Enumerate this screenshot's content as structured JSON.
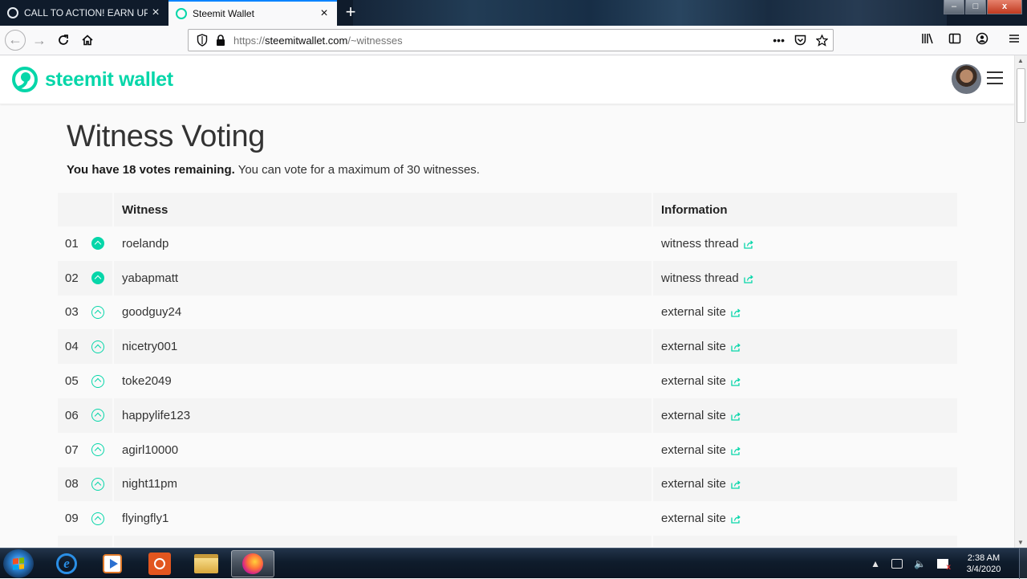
{
  "browser": {
    "tabs": [
      {
        "title": "CALL TO ACTION! EARN UPVO",
        "close": "×"
      },
      {
        "title": "Steemit Wallet",
        "close": "×"
      }
    ],
    "new_tab": "+",
    "url_scheme": "https://",
    "url_host": "steemitwallet.com",
    "url_path": "/~witnesses",
    "url_actions": "•••",
    "window_controls": {
      "minimize": "–",
      "maximize": "□",
      "close": "x"
    }
  },
  "site": {
    "brand": "steemit wallet",
    "brand_color": "#06d6a9"
  },
  "main": {
    "title": "Witness Voting",
    "votes_bold": "You have 18 votes remaining.",
    "votes_rest": " You can vote for a maximum of 30 witnesses.",
    "columns": {
      "witness": "Witness",
      "information": "Information"
    },
    "rows": [
      {
        "rank": "01",
        "name": "roelandp",
        "info": "witness thread",
        "voted": true
      },
      {
        "rank": "02",
        "name": "yabapmatt",
        "info": "witness thread",
        "voted": true
      },
      {
        "rank": "03",
        "name": "goodguy24",
        "info": "external site",
        "voted": false
      },
      {
        "rank": "04",
        "name": "nicetry001",
        "info": "external site",
        "voted": false
      },
      {
        "rank": "05",
        "name": "toke2049",
        "info": "external site",
        "voted": false
      },
      {
        "rank": "06",
        "name": "happylife123",
        "info": "external site",
        "voted": false
      },
      {
        "rank": "07",
        "name": "agirl10000",
        "info": "external site",
        "voted": false
      },
      {
        "rank": "08",
        "name": "night11pm",
        "info": "external site",
        "voted": false
      },
      {
        "rank": "09",
        "name": "flyingfly1",
        "info": "external site",
        "voted": false
      }
    ]
  },
  "taskbar": {
    "time": "2:38 AM",
    "date": "3/4/2020"
  }
}
